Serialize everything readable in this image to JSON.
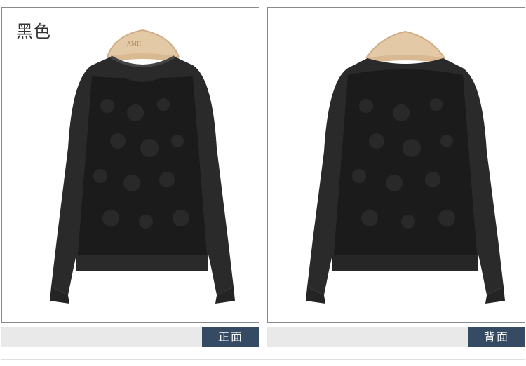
{
  "color_label": "黑色",
  "hanger_brand": "AMII",
  "front_caption": "正面",
  "back_caption": "背面",
  "colors": {
    "garment": "#2a2a2a",
    "lace": "#1b1b1b",
    "hanger": "#e3c9a6",
    "caption_tag": "#354a63",
    "caption_bar": "#e9e9e9"
  }
}
